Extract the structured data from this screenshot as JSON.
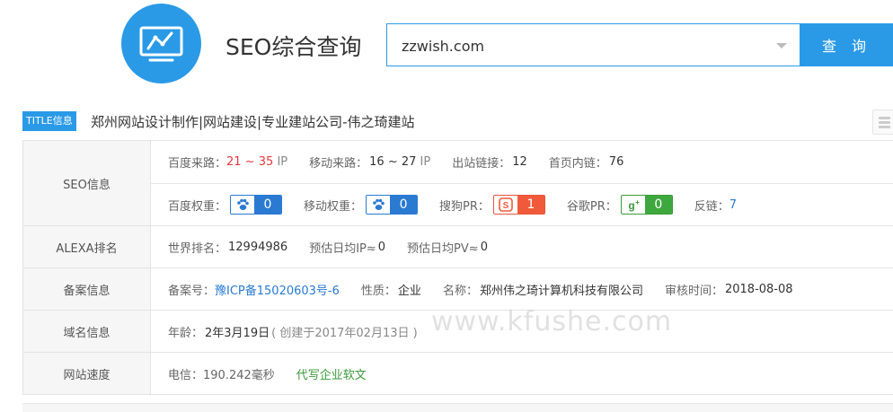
{
  "header": {
    "site_title": "SEO综合查询",
    "search_value": "zzwish.com",
    "search_button": "查 询",
    "logo_icon": "monitor-chart-icon"
  },
  "title_info": {
    "badge": "TITLE信息",
    "text": "郑州网站设计制作|网站建设|专业建站公司-伟之琦建站"
  },
  "seo": {
    "label": "SEO信息",
    "baidu_traffic_label": "百度来路：",
    "baidu_traffic_min": "21",
    "baidu_traffic_sep": "~",
    "baidu_traffic_max": "35",
    "baidu_traffic_unit": "IP",
    "mobile_traffic_label": "移动来路：",
    "mobile_traffic_value": "16 ~ 27",
    "mobile_traffic_unit": "IP",
    "outbound_links_label": "出站链接：",
    "outbound_links_value": "12",
    "home_inner_links_label": "首页内链：",
    "home_inner_links_value": "76",
    "baidu_weight_label": "百度权重：",
    "baidu_weight_value": "0",
    "mobile_weight_label": "移动权重：",
    "mobile_weight_value": "0",
    "sogou_pr_label": "搜狗PR：",
    "sogou_pr_value": "1",
    "google_pr_label": "谷歌PR：",
    "google_pr_value": "0",
    "backlinks_label": "反链：",
    "backlinks_value": "7"
  },
  "alexa": {
    "label": "ALEXA排名",
    "world_rank_label": "世界排名：",
    "world_rank_value": "12994986",
    "daily_ip_label": "预估日均IP≈",
    "daily_ip_value": "0",
    "daily_pv_label": "预估日均PV≈",
    "daily_pv_value": "0"
  },
  "icp": {
    "label": "备案信息",
    "number_label": "备案号：",
    "number_value": "豫ICP备15020603号-6",
    "nature_label": "性质：",
    "nature_value": "企业",
    "name_label": "名称：",
    "name_value": "郑州伟之琦计算机科技有限公司",
    "audit_label": "审核时间：",
    "audit_value": "2018-08-08"
  },
  "domain": {
    "label": "域名信息",
    "age_label": "年龄：",
    "age_value": "2年3月19日",
    "created_text": "( 创建于2017年02月13日 )"
  },
  "speed": {
    "label": "网站速度",
    "telecom_label": "电信：",
    "telecom_value": "190.242毫秒",
    "ad_link": "代写企业软文"
  },
  "watermark": "www.kfushe.com",
  "colors": {
    "accent": "#2a9ae6",
    "red": "#e4393c",
    "link_blue": "#2a7ad2",
    "green": "#3b9a3b"
  }
}
